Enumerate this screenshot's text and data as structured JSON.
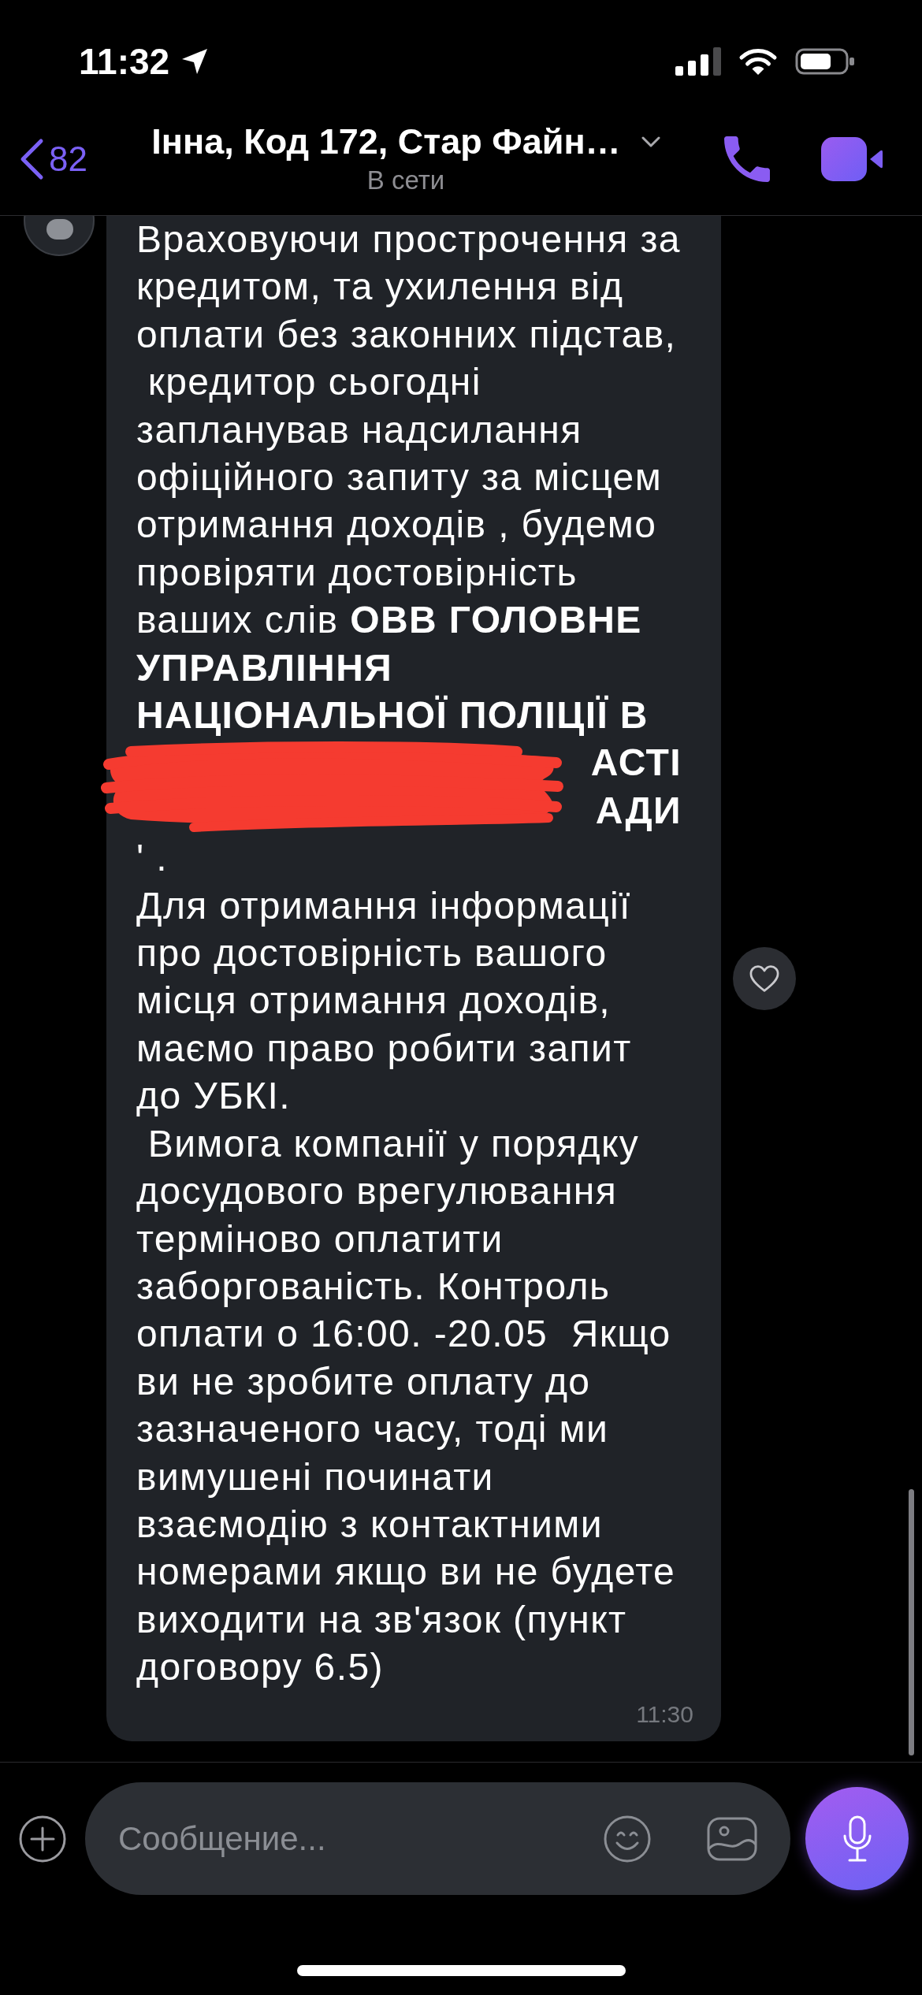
{
  "status_bar": {
    "time": "11:32"
  },
  "header": {
    "back_count": "82",
    "title": "Інна, Код 172, Стар Файн…",
    "subtitle": "В сети"
  },
  "message": {
    "lines": [
      "Враховуючи прострочення за",
      "кредитом, та ухилення від",
      "оплати без законних підстав,",
      " кредитор сьогодні",
      "запланував надсилання",
      "офіційного запиту за місцем",
      "отримання доходів , будемо",
      "провіряти достовірність",
      "ваших слів **ОВВ ГОЛОВНЕ**",
      "**УПРАВЛІННЯ**",
      "**НАЦІОНАЛЬНОЇ ПОЛІЦІЇ В**"
    ],
    "partly_hidden_lines": [
      "АСТІ",
      "АДИ"
    ],
    "lines_after": [
      "' .",
      "Для отримання інформації",
      "про достовірність вашого",
      "місця отримання доходів,",
      "маємо право робити запит",
      "до УБКІ.",
      " Вимога компанії у порядку",
      "досудового врегулювання",
      "терміново оплатити",
      "заборгованість. Контроль",
      "оплати о 16:00. -20.05  Якщо",
      "ви не зробите оплату до",
      "зазначеного часу, тоді ми",
      "вимушені починати",
      "взаємодію з контактними",
      "номерами якщо ви не будете",
      "виходити на зв'язок (пункт",
      "договору 6.5)"
    ],
    "time": "11:30"
  },
  "composer": {
    "placeholder": "Сообщение..."
  }
}
